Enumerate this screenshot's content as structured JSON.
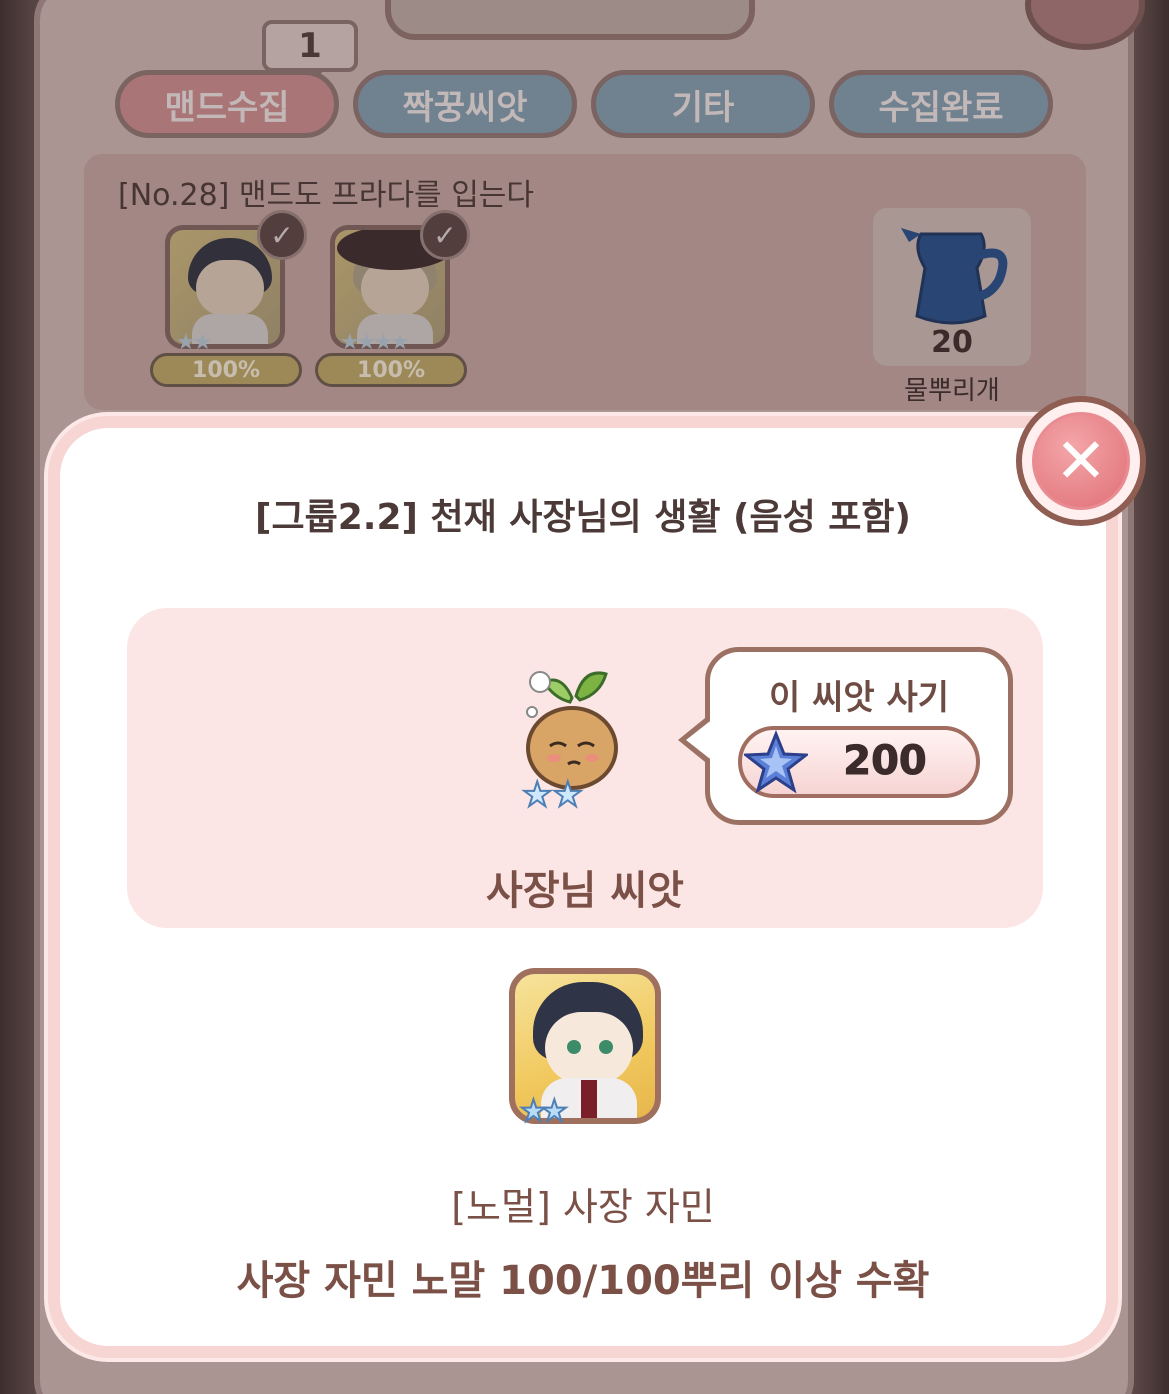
{
  "tabs": {
    "badge_count": "1",
    "items": [
      "맨드수집",
      "짝꿍씨앗",
      "기타",
      "수집완료"
    ],
    "active_index": 0
  },
  "collection_entry": {
    "title": "[No.28] 맨드도 프라다를 입는다",
    "characters": [
      {
        "icon": "character-portrait-dark-hair",
        "progress": "100%",
        "stars": 2,
        "checked": true
      },
      {
        "icon": "character-portrait-hat",
        "progress": "100%",
        "stars": 4,
        "checked": true
      }
    ],
    "reward": {
      "icon": "watering-can-icon",
      "quantity": "20",
      "name": "물뿌리개"
    }
  },
  "modal": {
    "title": "[그룹2.2] 천재 사장님의 생활 (음성 포함)",
    "seed": {
      "icon": "seed-mascot-icon",
      "stars": 2,
      "name": "사장님 씨앗",
      "buy_label": "이 씨앗 사기",
      "price": "200",
      "currency_icon": "blue-star-icon"
    },
    "character_card": {
      "icon": "character-card-portrait",
      "stars": 2,
      "name": "[노멀] 사장 자민",
      "condition": "사장 자민 노말 100/100뿌리 이상 수확"
    },
    "close_icon": "close-icon"
  },
  "colors": {
    "accent_pink": "#df6f76",
    "text_brown": "#7b5047",
    "seed_card_bg": "#fbe6e5",
    "tab_active": "#c88b8e",
    "tab_inactive": "#7f9aae"
  }
}
